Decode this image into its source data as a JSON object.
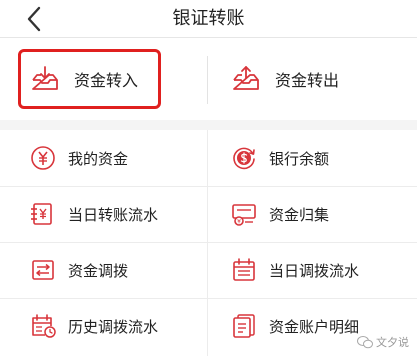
{
  "header": {
    "title": "银证转账"
  },
  "transfer": {
    "in_label": "资金转入",
    "out_label": "资金转出"
  },
  "menu": [
    {
      "label": "我的资金",
      "icon": "yen-circle-icon"
    },
    {
      "label": "银行余额",
      "icon": "dollar-refresh-icon"
    },
    {
      "label": "当日转账流水",
      "icon": "yen-document-icon"
    },
    {
      "label": "资金归集",
      "icon": "fund-collect-icon"
    },
    {
      "label": "资金调拨",
      "icon": "transfer-arrows-icon"
    },
    {
      "label": "当日调拨流水",
      "icon": "calendar-list-icon"
    },
    {
      "label": "历史调拨流水",
      "icon": "calendar-clock-icon"
    },
    {
      "label": "资金账户明细",
      "icon": "ledger-icon"
    }
  ],
  "watermark": {
    "text": "文夕说"
  },
  "colors": {
    "accent": "#d8353b",
    "highlight": "#e0201f"
  }
}
